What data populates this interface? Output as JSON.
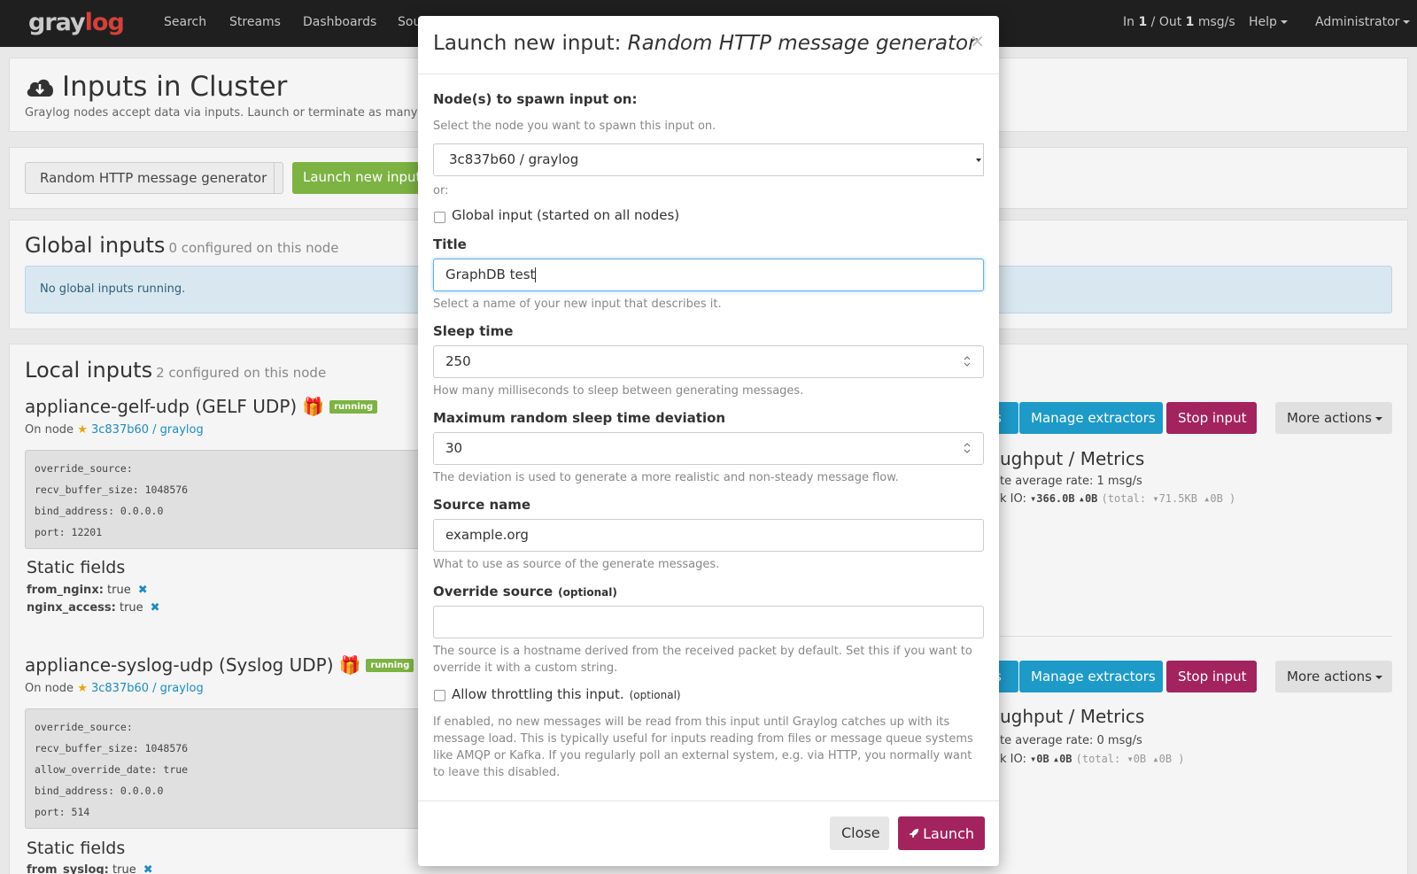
{
  "nav": {
    "logo_a": "gray",
    "logo_b": "log",
    "items": [
      "Search",
      "Streams",
      "Dashboards",
      "Sou"
    ],
    "throughput_in_label": "In ",
    "throughput_in": "1",
    "throughput_mid": " / Out ",
    "throughput_out": "1",
    "throughput_unit": " msg/s",
    "help": "Help",
    "user": "Administrator"
  },
  "page": {
    "title": "Inputs in Cluster",
    "subtitle": "Graylog nodes accept data via inputs. Launch or terminate as many input",
    "input_type_selected": "Random HTTP message generator",
    "launch_button": "Launch new input",
    "global_title": "Global inputs",
    "global_count": "0 configured on this node",
    "global_empty": "No global inputs running.",
    "local_title": "Local inputs",
    "local_count": "2 configured on this node"
  },
  "inputs": [
    {
      "title": "appliance-gelf-udp (GELF UDP)",
      "state": "running",
      "on_node_label": "On node",
      "node": "3c837b60 / graylog",
      "config": [
        "override_source:",
        "recv_buffer_size: 1048576",
        "bind_address: 0.0.0.0",
        "port: 12201"
      ],
      "static_fields_title": "Static fields",
      "static_fields": [
        {
          "key": "from_nginx:",
          "value": "true"
        },
        {
          "key": "nginx_access:",
          "value": "true"
        }
      ],
      "btn_partial": "s",
      "btn_extractors": "Manage extractors",
      "btn_stop": "Stop input",
      "btn_more": "More actions",
      "tput_title": "ughput / Metrics",
      "tput_rate": "te average rate: 1 msg/s",
      "net_label": "k IO: ",
      "net_in": "▾366.0B",
      "net_out": "▴0B",
      "net_total": "(total: ▾71.5KB ▴0B )"
    },
    {
      "title": "appliance-syslog-udp (Syslog UDP)",
      "state": "running",
      "on_node_label": "On node",
      "node": "3c837b60 / graylog",
      "config": [
        "override_source:",
        "recv_buffer_size: 1048576",
        "allow_override_date: true",
        "bind_address: 0.0.0.0",
        "port: 514"
      ],
      "static_fields_title": "Static fields",
      "static_fields": [
        {
          "key": "from_syslog:",
          "value": "true"
        }
      ],
      "btn_partial": "s",
      "btn_extractors": "Manage extractors",
      "btn_stop": "Stop input",
      "btn_more": "More actions",
      "tput_title": "ughput / Metrics",
      "tput_rate": "te average rate: 0 msg/s",
      "net_label": "k IO: ",
      "net_in": "▾0B",
      "net_out": "▴0B",
      "net_total": "(total: ▾0B ▴0B )"
    }
  ],
  "modal": {
    "title_prefix": "Launch new input: ",
    "title_type": "Random HTTP message generator",
    "close_glyph": "×",
    "node_label": "Node(s) to spawn input on:",
    "node_help": "Select the node you want to spawn this input on.",
    "node_value": "3c837b60 / graylog",
    "or": "or:",
    "global_checkbox": "Global input (started on all nodes)",
    "title_label": "Title",
    "title_value": "GraphDB test",
    "title_help": "Select a name of your new input that describes it.",
    "sleep_label": "Sleep time",
    "sleep_value": "250",
    "sleep_help": "How many milliseconds to sleep between generating messages.",
    "dev_label": "Maximum random sleep time deviation",
    "dev_value": "30",
    "dev_help": "The deviation is used to generate a more realistic and non-steady message flow.",
    "source_label": "Source name",
    "source_value": "example.org",
    "source_help": "What to use as source of the generate messages.",
    "override_label": "Override source",
    "optional": "(optional)",
    "override_value": "",
    "override_help": "The source is a hostname derived from the received packet by default. Set this if you want to override it with a custom string.",
    "throttle_label": "Allow throttling this input.",
    "throttle_help": "If enabled, no new messages will be read from this input until Graylog catches up with its message load. This is typically useful for inputs reading from files or message queue systems like AMQP or Kafka. If you regularly poll an external system, e.g. via HTTP, you normally want to leave this disabled.",
    "close_button": "Close",
    "launch_button": "Launch"
  },
  "colors": {
    "navbar": "#1f1f1f",
    "launch_green": "#7cb342",
    "extractors_blue": "#1e9ac9",
    "stop_crimson": "#a3235e",
    "link_blue": "#1e8bc3"
  }
}
